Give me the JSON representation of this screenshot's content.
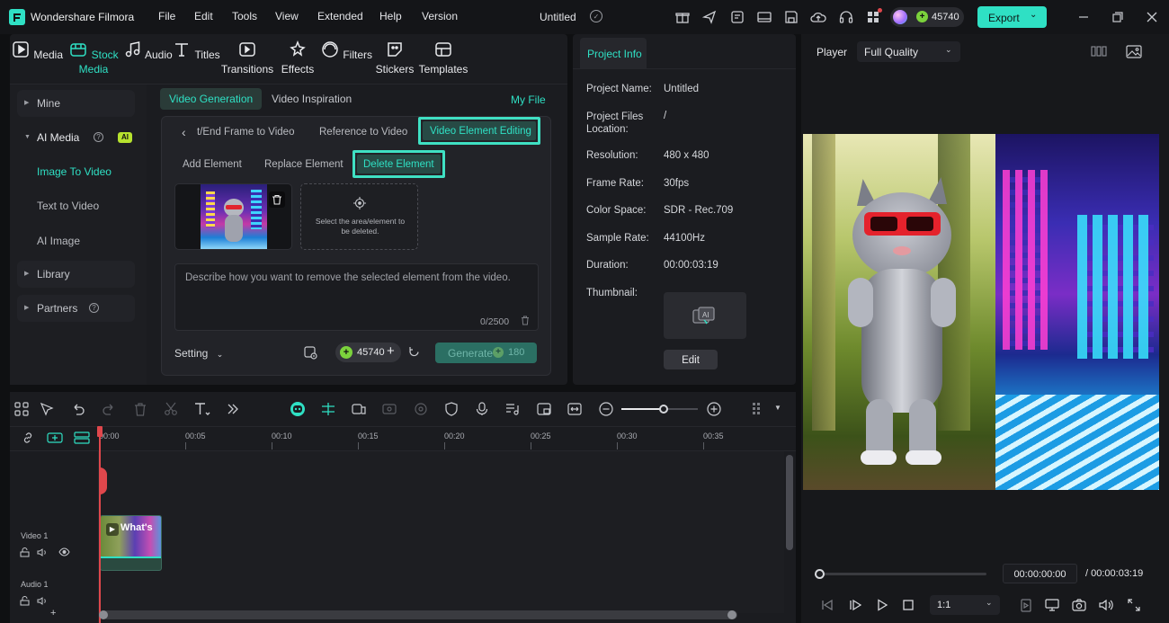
{
  "app": {
    "name": "Wondershare Filmora",
    "doc_title": "Untitled",
    "credits": "45740",
    "export_label": "Export"
  },
  "menu": [
    "File",
    "Edit",
    "Tools",
    "View",
    "Extended",
    "Help",
    "Version"
  ],
  "media_tabs": [
    {
      "label": "Media",
      "icon": "media-icon"
    },
    {
      "label": "Stock Media",
      "icon": "stock-media-icon"
    },
    {
      "label": "Audio",
      "icon": "music-icon"
    },
    {
      "label": "Titles",
      "icon": "text-icon"
    },
    {
      "label": "Transitions",
      "icon": "transitions-icon"
    },
    {
      "label": "Effects",
      "icon": "effects-icon"
    },
    {
      "label": "Filters",
      "icon": "filters-icon"
    },
    {
      "label": "Stickers",
      "icon": "stickers-icon"
    },
    {
      "label": "Templates",
      "icon": "templates-icon"
    }
  ],
  "sidebar": {
    "mine": "Mine",
    "ai_media": "AI Media",
    "ai_badge": "AI",
    "image_to_video": "Image To Video",
    "text_to_video": "Text to Video",
    "ai_image": "AI Image",
    "library": "Library",
    "partners": "Partners"
  },
  "gen": {
    "tab_video_generation": "Video Generation",
    "tab_video_inspiration": "Video Inspiration",
    "my_file": "My File",
    "mode_end_frame": "t/End Frame to Video",
    "mode_reference": "Reference to Video",
    "mode_element_editing": "Video Element Editing",
    "sub_add": "Add Element",
    "sub_replace": "Replace Element",
    "sub_delete": "Delete Element",
    "select_hint": "Select the area/element to be deleted.",
    "prompt_placeholder": "Describe how you want to remove the selected element from the video.",
    "char_count": "0/2500",
    "setting": "Setting",
    "credits": "45740",
    "generate": "Generate",
    "generate_cost": "180"
  },
  "project_info": {
    "tab": "Project Info",
    "rows": [
      {
        "label": "Project Name:",
        "value": "Untitled"
      },
      {
        "label": "Project Files Location:",
        "value": "/"
      },
      {
        "label": "Resolution:",
        "value": "480 x 480"
      },
      {
        "label": "Frame Rate:",
        "value": "30fps"
      },
      {
        "label": "Color Space:",
        "value": "SDR - Rec.709"
      },
      {
        "label": "Sample Rate:",
        "value": "44100Hz"
      },
      {
        "label": "Duration:",
        "value": "00:00:03:19"
      },
      {
        "label": "Thumbnail:",
        "value": ""
      }
    ],
    "edit_label": "Edit"
  },
  "player": {
    "label": "Player",
    "quality": "Full Quality",
    "current_time": "00:00:00:00",
    "total_time": "/ 00:00:03:19",
    "ratio": "1:1",
    "progress": 0.0
  },
  "timeline": {
    "ticks": [
      "00:00",
      "00:05",
      "00:10",
      "00:15",
      "00:20",
      "00:25",
      "00:30",
      "00:35"
    ],
    "video_track": "Video 1",
    "audio_track": "Audio 1",
    "clip_title": "What's",
    "zoom": 0.55
  },
  "colors": {
    "accent": "#2fe0c4",
    "highlight": "#3fe0c3",
    "playhead": "#e0474c"
  }
}
